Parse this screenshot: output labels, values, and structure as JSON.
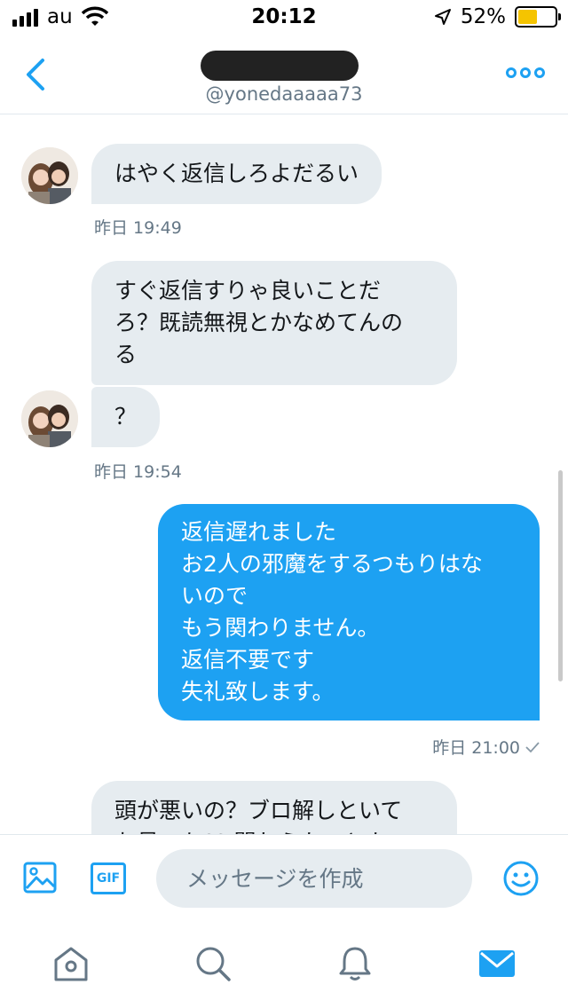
{
  "status_bar": {
    "carrier": "au",
    "time": "20:12",
    "battery_percent": "52%",
    "battery_level": 0.52,
    "icons": [
      "signal-icon",
      "wifi-icon",
      "location-arrow-icon",
      "battery-icon"
    ]
  },
  "header": {
    "handle": "@yonedaaaaa73",
    "back_icon": "chevron-left-icon",
    "more_icon": "more-dots-icon"
  },
  "messages": [
    {
      "direction": "incoming",
      "text": "はやく返信しろよだるい"
    },
    {
      "direction": "incoming",
      "timestamp": "昨日 19:49"
    },
    {
      "direction": "incoming",
      "lines": [
        "すぐ返信すりゃ良いことだ",
        "ろ？既読無視とかなめてんの",
        "る"
      ]
    },
    {
      "direction": "incoming",
      "text": "？"
    },
    {
      "direction": "incoming",
      "timestamp": "昨日 19:54"
    },
    {
      "direction": "outgoing",
      "lines": [
        "返信遅れました",
        "お2人の邪魔をするつもりはな",
        "いので",
        "もう関わりません。",
        "返信不要です",
        "失礼致します。"
      ]
    },
    {
      "direction": "outgoing",
      "timestamp": "昨日 21:00",
      "read_icon": "check-icon"
    },
    {
      "direction": "incoming",
      "lines": [
        "頭が悪いの？ブロ解しといて",
        "お易っち?? 関わらたいとか"
      ]
    }
  ],
  "composer": {
    "placeholder": "メッセージを作成",
    "gif_label": "GIF",
    "icons": [
      "photo-icon",
      "gif-icon",
      "emoji-icon"
    ]
  },
  "tabbar": {
    "tabs": [
      "home-icon",
      "search-icon",
      "notifications-icon",
      "messages-icon"
    ],
    "active": "messages-icon"
  },
  "colors": {
    "accent": "#1da1f2",
    "incoming_bubble": "#e6ecf0",
    "muted_text": "#657786",
    "tab_inactive": "#657786"
  }
}
